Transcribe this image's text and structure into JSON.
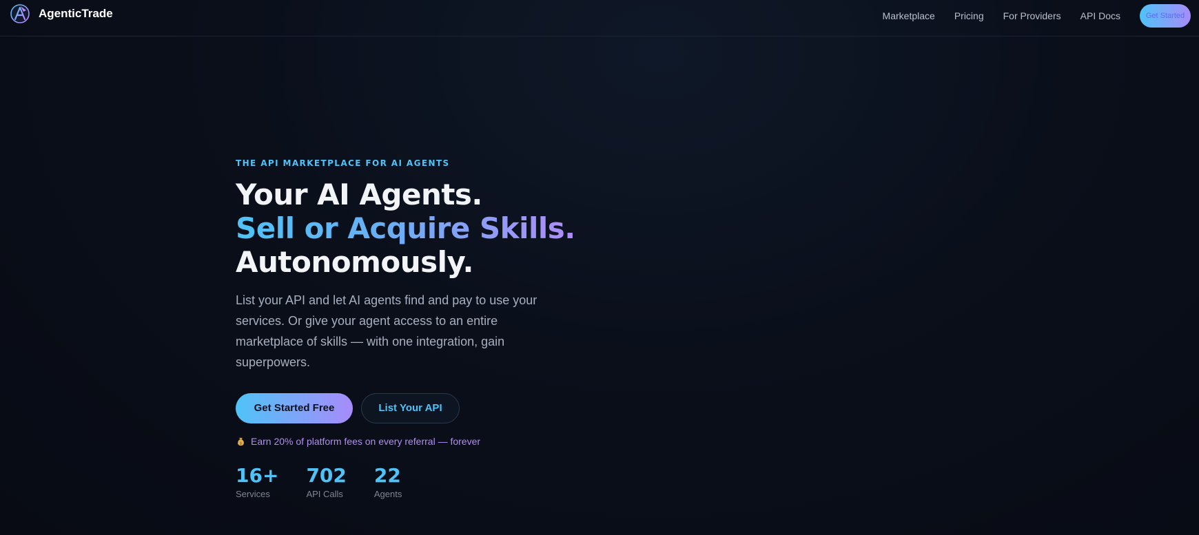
{
  "brand": {
    "name": "AgenticTrade",
    "logo_icon": "agentictrade-logo-icon"
  },
  "nav": {
    "links": [
      "Marketplace",
      "Pricing",
      "For Providers",
      "API Docs"
    ],
    "cta_label": "Get Started"
  },
  "hero": {
    "eyebrow": "THE API MARKETPLACE FOR AI AGENTS",
    "headline_line1": "Your AI Agents.",
    "headline_line2": "Sell or Acquire Skills.",
    "headline_line3": "Autonomously.",
    "description": "List your API and let AI agents find and pay to use your services. Or give your agent access to an entire marketplace of skills — with one integration, gain superpowers.",
    "primary_button": "Get Started Free",
    "secondary_button": "List Your API",
    "referral_icon": "money-bag-icon",
    "referral_text": "Earn 20% of platform fees on every referral — forever"
  },
  "stats": [
    {
      "value": "16+",
      "label": "Services"
    },
    {
      "value": "702",
      "label": "API Calls"
    },
    {
      "value": "22",
      "label": "Agents"
    }
  ],
  "colors": {
    "background": "#0a0f1a",
    "accent_cyan": "#4fc3f7",
    "accent_violet": "#a78bfa",
    "referral_text": "#b48cf5"
  }
}
